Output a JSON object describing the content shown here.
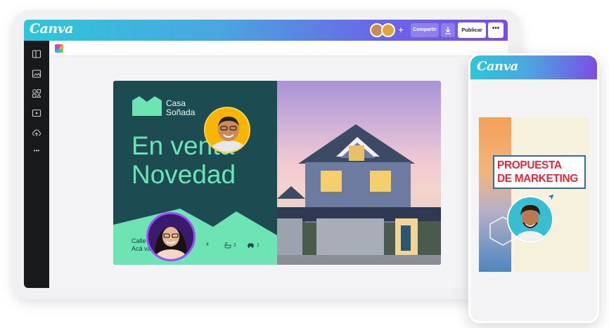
{
  "app": {
    "logo_text": "Canva",
    "share_label": "Compartir",
    "publish_label": "Publicar",
    "more_label": "•••",
    "plus_label": "+"
  },
  "sidebar": {
    "items": [
      "panel-icon",
      "image-icon",
      "elements-icon",
      "video-icon",
      "upload-icon",
      "more-icon"
    ],
    "more_label": "•••"
  },
  "design": {
    "brand_name_line1": "Casa",
    "brand_name_line2": "Soñada",
    "headline_line1": "En venta",
    "headline_line2": "Novedad",
    "address_line1": "Calle Es",
    "address_line2": "Acá va t",
    "features": [
      {
        "icon": "bed-icon",
        "value": "4"
      },
      {
        "icon": "bath-icon",
        "value": "2"
      },
      {
        "icon": "car-icon",
        "value": "1"
      }
    ],
    "colors": {
      "dark": "#1c4b52",
      "mint": "#6ee4b4"
    }
  },
  "phone": {
    "logo_text": "Canva",
    "badge_line1": "PROPUESTA",
    "badge_line2": "DE MARKETING",
    "badge_color": "#e8263b"
  },
  "colors": {
    "brand_gradient_start": "#2ec6d8",
    "brand_gradient_end": "#7b4ee6",
    "sidebar": "#18191b"
  }
}
